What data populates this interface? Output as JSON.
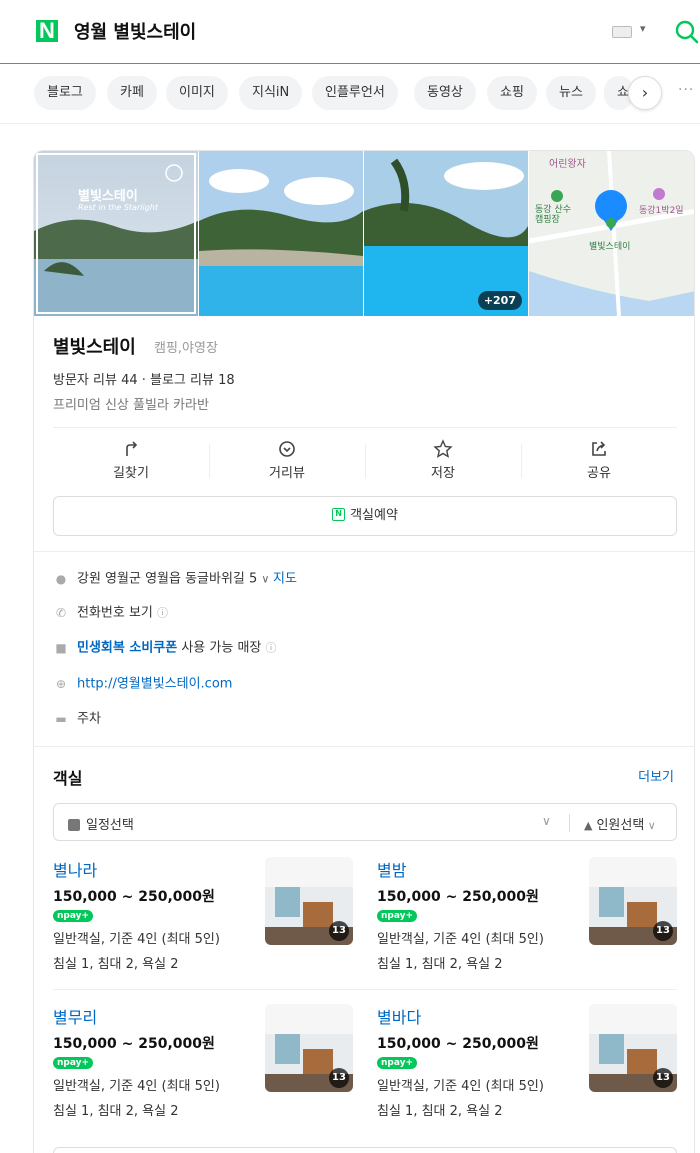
{
  "search": {
    "query": "영월 별빛스테이",
    "logo": "N"
  },
  "tabs": [
    "블로그",
    "카페",
    "이미지",
    "지식iN",
    "인플루언서",
    "동영상",
    "쇼핑",
    "뉴스",
    "쇼"
  ],
  "photos": {
    "photo1_overlay": "별빛스테이",
    "photo1_sub": "Rest in the Starlight",
    "photo3_count": "+207",
    "map_labels": {
      "kids": "어린왕자",
      "camp": "동강 산수\n캠핑장",
      "place": "별빛스테이",
      "right": "동강1박2일"
    }
  },
  "place": {
    "name": "별빛스테이",
    "category": "캠핑,야영장",
    "reviews": "방문자 리뷰 44 · 블로그 리뷰 18",
    "description": "프리미엄 신상 풀빌라 카라반"
  },
  "actions": [
    {
      "label": "길찾기",
      "icon": "directions-icon"
    },
    {
      "label": "거리뷰",
      "icon": "street-view-icon"
    },
    {
      "label": "저장",
      "icon": "star-icon"
    },
    {
      "label": "공유",
      "icon": "share-icon"
    }
  ],
  "reserve_label": "객실예약",
  "info": {
    "address": "강원 영월군 영월읍 동글바위길 5",
    "map_link": "지도",
    "phone": "전화번호 보기",
    "coupon_bold": "민생회복 소비쿠폰",
    "coupon_rest": " 사용 가능 매장",
    "website": "http://영월별빛스테이.com",
    "parking": "주차"
  },
  "rooms_section": {
    "title": "객실",
    "more": "더보기",
    "date_select": "일정선택",
    "people_select": "인원선택"
  },
  "rooms": [
    {
      "name": "별나라",
      "price": "150,000 ~ 250,000원",
      "pay": "npay+",
      "desc": "일반객실, 기준 4인 (최대 5인)",
      "beds": "침실 1, 침대 2, 욕실 2",
      "count": "13"
    },
    {
      "name": "별밤",
      "price": "150,000 ~ 250,000원",
      "pay": "npay+",
      "desc": "일반객실, 기준 4인 (최대 5인)",
      "beds": "침실 1, 침대 2, 욕실 2",
      "count": "13"
    },
    {
      "name": "별무리",
      "price": "150,000 ~ 250,000원",
      "pay": "npay+",
      "desc": "일반객실, 기준 4인 (최대 5인)",
      "beds": "침실 1, 침대 2, 욕실 2",
      "count": "13"
    },
    {
      "name": "별바다",
      "price": "150,000 ~ 250,000원",
      "pay": "npay+",
      "desc": "일반객실, 기준 4인 (최대 5인)",
      "beds": "침실 1, 침대 2, 욕실 2",
      "count": "13"
    }
  ],
  "colors": {
    "naver_green": "#03c75a",
    "link_blue": "#0068c3",
    "map_pin": "#1a8cff"
  }
}
